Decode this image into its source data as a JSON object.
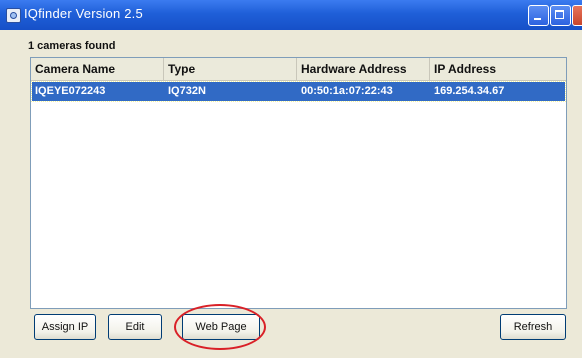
{
  "window": {
    "title": "IQfinder Version 2.5",
    "icon": "camera-finder-icon"
  },
  "status": {
    "count_text": "1 cameras found"
  },
  "table": {
    "columns": [
      "Camera Name",
      "Type",
      "Hardware Address",
      "IP Address"
    ],
    "rows": [
      {
        "camera_name": "IQEYE072243",
        "type": "IQ732N",
        "hardware_address": "00:50:1a:07:22:43",
        "ip_address": "169.254.34.67",
        "selected": true
      }
    ]
  },
  "buttons": {
    "assign_ip": "Assign IP",
    "edit": "Edit",
    "web_page": "Web Page",
    "refresh": "Refresh"
  },
  "annotation": {
    "highlight_color": "#d92027",
    "highlighted": "web_page"
  },
  "colors": {
    "titlebar": "#1f5fd8",
    "selection": "#316ac5",
    "window_bg": "#ece9d8"
  }
}
